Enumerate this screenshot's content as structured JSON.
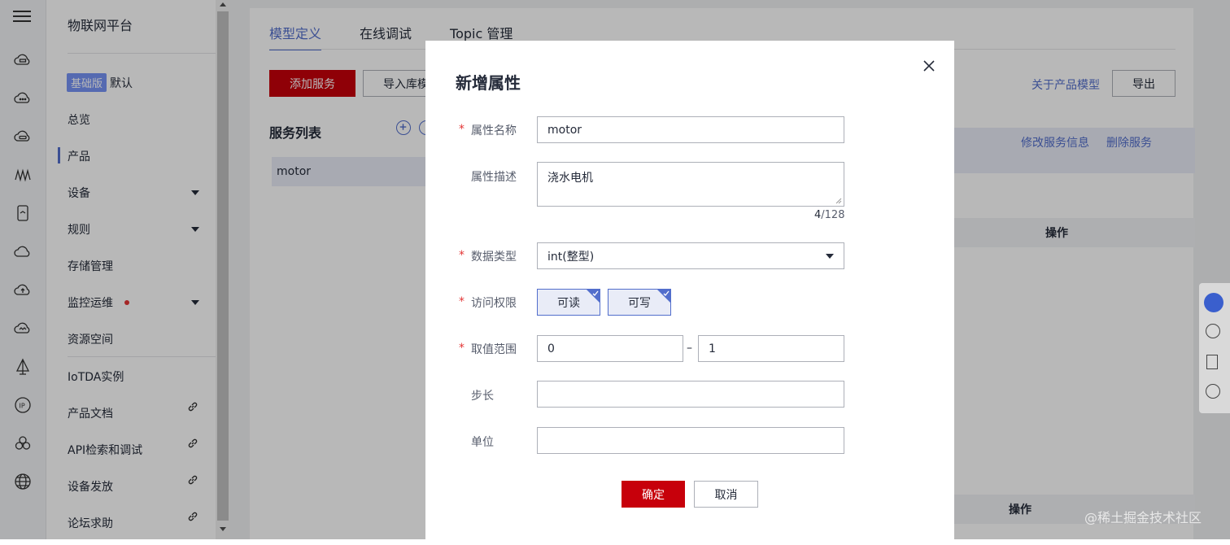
{
  "rail": {
    "icons": [
      "menu-icon",
      "cloud-box-icon",
      "cloud-dots-icon",
      "cloud-storage-icon",
      "wave-icon",
      "tablet-icon",
      "cloud-icon",
      "cloud-up-icon",
      "cloud-wave-icon",
      "sail-icon",
      "ip-icon",
      "cluster-icon",
      "globe-icon"
    ]
  },
  "nav": {
    "brand": "物联网平台",
    "edition_badge": "基础版",
    "edition_name": "默认",
    "items": [
      {
        "label": "总览"
      },
      {
        "label": "产品",
        "active": true
      },
      {
        "label": "设备",
        "expandable": true
      },
      {
        "label": "规则",
        "expandable": true
      },
      {
        "label": "存储管理"
      },
      {
        "label": "监控运维",
        "expandable": true,
        "alert_dot": true
      },
      {
        "label": "资源空间"
      },
      {
        "label": "IoTDA实例"
      },
      {
        "label": "产品文档",
        "external": true
      },
      {
        "label": "API检索和调试",
        "external": true
      },
      {
        "label": "设备发放",
        "external": true
      },
      {
        "label": "论坛求助",
        "external": true
      }
    ]
  },
  "main": {
    "tabs": [
      {
        "label": "模型定义",
        "active": true
      },
      {
        "label": "在线调试"
      },
      {
        "label": "Topic 管理"
      }
    ],
    "add_service_btn": "添加服务",
    "import_btn": "导入库模",
    "about_model_link": "关于产品模型",
    "export_btn": "导出",
    "service_list_title": "服务列表",
    "service_items": [
      "motor"
    ],
    "edit_service_link": "修改服务信息",
    "delete_service_link": "删除服务",
    "table_op_header": "操作",
    "table_op_header_2": "操作"
  },
  "modal": {
    "title": "新增属性",
    "fields": {
      "name": {
        "label": "属性名称",
        "value": "motor",
        "required": true
      },
      "desc": {
        "label": "属性描述",
        "value": "浇水电机",
        "count": "4",
        "max": "/128"
      },
      "type": {
        "label": "数据类型",
        "value": "int(整型)",
        "required": true
      },
      "access": {
        "label": "访问权限",
        "required": true,
        "options": [
          {
            "label": "可读",
            "selected": true
          },
          {
            "label": "可写",
            "selected": true
          }
        ]
      },
      "range": {
        "label": "取值范围",
        "required": true,
        "min": "0",
        "dash": "–",
        "max": "1"
      },
      "step": {
        "label": "步长",
        "value": ""
      },
      "unit": {
        "label": "单位",
        "value": ""
      }
    },
    "required_mark": "*",
    "ok_btn": "确定",
    "cancel_btn": "取消"
  },
  "watermark": "@稀土掘金技术社区",
  "colors": {
    "brand_red": "#c7000b",
    "accent_blue": "#526ecc",
    "badge_blue": "#7693f5"
  }
}
